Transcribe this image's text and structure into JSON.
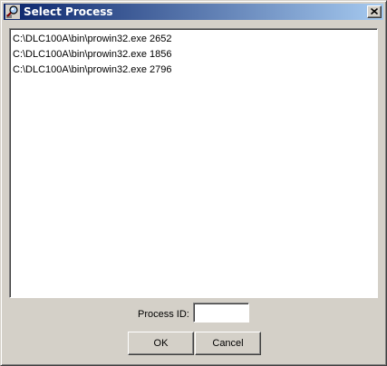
{
  "window": {
    "title": "Select Process",
    "icons": {
      "app": "magnifier-process-icon",
      "close": "close-icon"
    }
  },
  "process_list": {
    "items": [
      "C:\\DLC100A\\bin\\prowin32.exe 2652",
      "C:\\DLC100A\\bin\\prowin32.exe 1856",
      "C:\\DLC100A\\bin\\prowin32.exe 2796"
    ]
  },
  "process_id": {
    "label": "Process ID:",
    "value": ""
  },
  "buttons": {
    "ok": "OK",
    "cancel": "Cancel"
  },
  "colors": {
    "titlebar_start": "#0a246a",
    "titlebar_end": "#a6caf0",
    "face": "#d4d0c8"
  }
}
